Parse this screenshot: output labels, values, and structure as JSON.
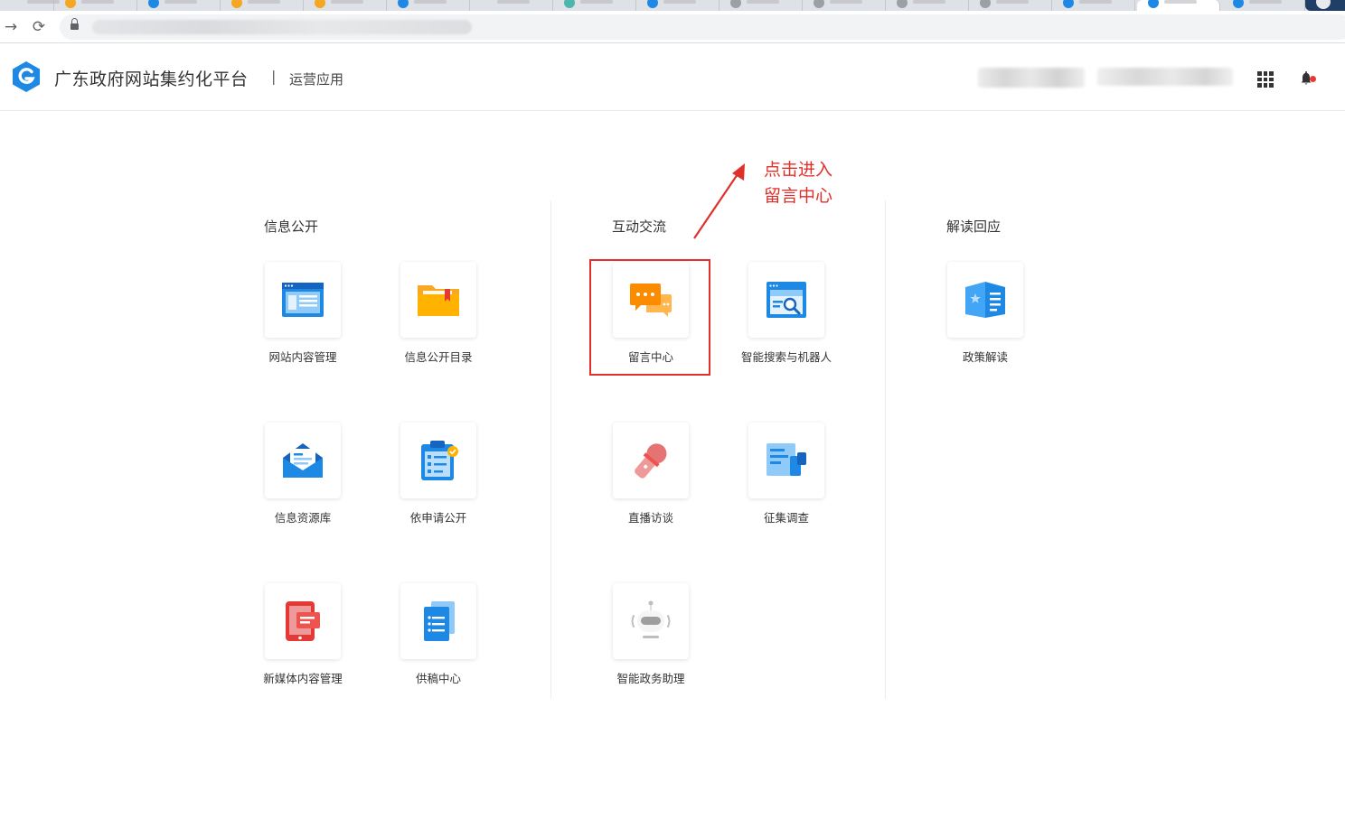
{
  "header": {
    "title": "广东政府网站集约化平台",
    "separator": "|",
    "subtitle": "运营应用"
  },
  "sections": [
    {
      "title": "信息公开",
      "items": [
        {
          "label": "网站内容管理",
          "icon": "browser-window-icon"
        },
        {
          "label": "信息公开目录",
          "icon": "folder-icon"
        },
        {
          "label": "信息资源库",
          "icon": "envelope-icon"
        },
        {
          "label": "依申请公开",
          "icon": "clipboard-icon"
        },
        {
          "label": "新媒体内容管理",
          "icon": "tablet-icon"
        },
        {
          "label": "供稿中心",
          "icon": "documents-icon"
        }
      ]
    },
    {
      "title": "互动交流",
      "items": [
        {
          "label": "留言中心",
          "icon": "chat-bubbles-icon"
        },
        {
          "label": "智能搜索与机器人",
          "icon": "search-window-icon"
        },
        {
          "label": "直播访谈",
          "icon": "microphone-icon"
        },
        {
          "label": "征集调查",
          "icon": "survey-icon"
        },
        {
          "label": "智能政务助理",
          "icon": "robot-icon"
        }
      ]
    },
    {
      "title": "解读回应",
      "items": [
        {
          "label": "政策解读",
          "icon": "book-icon"
        }
      ]
    }
  ],
  "annotation": {
    "line1": "点击进入",
    "line2": "留言中心",
    "color": "#e0302a"
  },
  "colors": {
    "brand_blue": "#1e88e5",
    "orange": "#fb8c00",
    "pink_red": "#ef5350"
  }
}
